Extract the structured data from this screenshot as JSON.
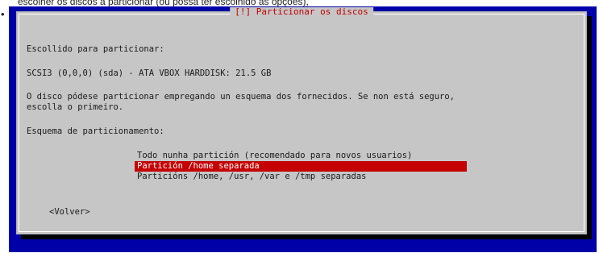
{
  "caption": "escolher os discos a particionar (ou possa ter escolhido as opções),",
  "bullet": "•",
  "dialog": {
    "title": "[!] Particionar os discos",
    "chosen_label": "Escollido para particionar:",
    "disk_line": "SCSI3 (0,0,0) (sda) - ATA VBOX HARDDISK: 21.5 GB",
    "description_line1": "O disco pódese particionar empregando un esquema dos fornecidos. Se non está seguro,",
    "description_line2": "escolla o primeiro.",
    "scheme_label": "Esquema de particionamento:",
    "options": [
      "Todo nunha partición (recomendado para novos usuarios)",
      "Partición /home separada",
      "Particións /home, /usr, /var e /tmp separadas"
    ],
    "selected_index": 1,
    "back_button": "<Volver>"
  },
  "colors": {
    "background_blue": "#0000a8",
    "dialog_gray": "#c6c6c6",
    "accent_red": "#c40000"
  }
}
